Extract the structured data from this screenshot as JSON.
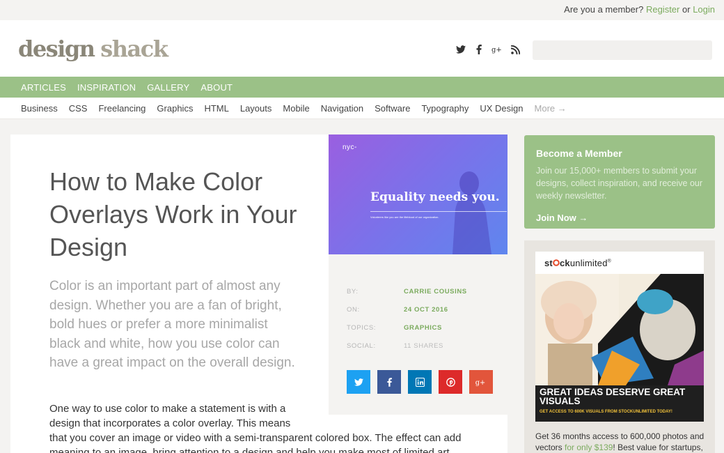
{
  "topbar": {
    "prompt": "Are you a member?",
    "register": "Register",
    "or": "or",
    "login": "Login"
  },
  "header": {
    "logo_word1": "design",
    "logo_word2": "shack",
    "social_icons": [
      "twitter-icon",
      "facebook-icon",
      "google-plus-icon",
      "rss-icon"
    ],
    "search_placeholder": ""
  },
  "nav": {
    "items": [
      "ARTICLES",
      "INSPIRATION",
      "GALLERY",
      "ABOUT"
    ]
  },
  "categories": {
    "items": [
      "Business",
      "CSS",
      "Freelancing",
      "Graphics",
      "HTML",
      "Layouts",
      "Mobile",
      "Navigation",
      "Software",
      "Typography",
      "UX Design"
    ],
    "more": "More →"
  },
  "article": {
    "title": "How to Make Color Overlays Work in Your Design",
    "lead": "Color is an important part of almost any design. Whether you are a fan of bright, bold hues or prefer a more minimalist black and white, how you use color can have a great impact on the overall design.",
    "body_p1": "One way to use color to make a statement is with a design that incorporates a color overlay. This means",
    "body_p2": "that you cover an image or video with a semi-transparent colored box. The effect can add meaning to an image, bring attention to a design and help you make most of limited art"
  },
  "hero": {
    "brand": "nyc-",
    "headline": "Equality needs you.",
    "sub": "Volunteers like you are the lifeblood of our organization."
  },
  "meta": {
    "by_label": "BY:",
    "by_value": "CARRIE COUSINS",
    "on_label": "ON:",
    "on_value": "24 OCT 2016",
    "topics_label": "TOPICS:",
    "topics_value": "GRAPHICS",
    "social_label": "SOCIAL:",
    "social_value": "11 SHARES",
    "share_buttons": [
      {
        "icon": "twitter-icon",
        "color": "#1da1f2"
      },
      {
        "icon": "facebook-icon",
        "color": "#3b5998"
      },
      {
        "icon": "linkedin-icon",
        "color": "#0077b5"
      },
      {
        "icon": "pinterest-icon",
        "color": "#dd2a2a"
      },
      {
        "icon": "google-plus-icon",
        "color": "#e2553b"
      }
    ]
  },
  "member_box": {
    "heading": "Become a Member",
    "text": "Join our 15,000+ members to submit your designs, collect inspiration, and receive our weekly newsletter.",
    "cta": "Join Now →"
  },
  "ad": {
    "logo_a": "st",
    "logo_b": "ck",
    "logo_c": "unlimited",
    "logo_mark": "®",
    "headline": "GREAT IDEAS DESERVE GREAT VISUALS",
    "subline": "GET ACCESS TO 600K VISUALS FROM STOCKUNLIMITED TODAY!",
    "foot_a": "Get 36 months access to 600,000 photos and vectors",
    "foot_hl": "for only $139",
    "foot_b": "! Best value for startups,"
  },
  "colors": {
    "accent": "#9bc187",
    "link": "#7bab5e",
    "background": "#f4f3f1"
  }
}
